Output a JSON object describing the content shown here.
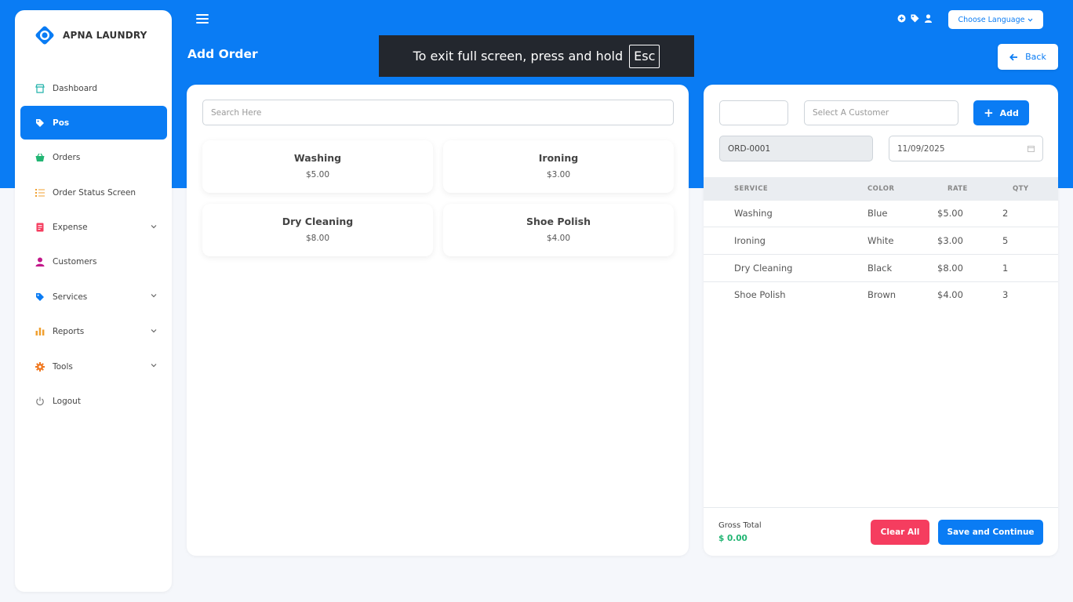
{
  "brand": {
    "name": "APNA LAUNDRY"
  },
  "sidebar": {
    "items": [
      {
        "label": "Dashboard",
        "icon": "shop-icon",
        "active": false
      },
      {
        "label": "Pos",
        "icon": "tag-icon",
        "active": true
      },
      {
        "label": "Orders",
        "icon": "basket-icon",
        "active": false
      },
      {
        "label": "Order Status Screen",
        "icon": "list-icon",
        "active": false
      },
      {
        "label": "Expense",
        "icon": "receipt-icon",
        "active": false,
        "expandable": true
      },
      {
        "label": "Customers",
        "icon": "user-icon",
        "active": false
      },
      {
        "label": "Services",
        "icon": "tag-icon",
        "active": false,
        "expandable": true
      },
      {
        "label": "Reports",
        "icon": "bar-chart-icon",
        "active": false,
        "expandable": true
      },
      {
        "label": "Tools",
        "icon": "gear-icon",
        "active": false,
        "expandable": true
      },
      {
        "label": "Logout",
        "icon": "power-icon",
        "active": false
      }
    ]
  },
  "header": {
    "language_label": "Choose Language",
    "page_title": "Add Order",
    "back_label": "Back",
    "icons": [
      "plus-circle-icon",
      "tag-icon",
      "user-icon"
    ]
  },
  "fullscreen_banner": {
    "text": "To exit full screen, press and hold",
    "key": "Esc"
  },
  "pos": {
    "search_placeholder": "Search Here",
    "services": [
      {
        "name": "Washing",
        "price": "$5.00"
      },
      {
        "name": "Ironing",
        "price": "$3.00"
      },
      {
        "name": "Dry Cleaning",
        "price": "$8.00"
      },
      {
        "name": "Shoe Polish",
        "price": "$4.00"
      }
    ]
  },
  "order": {
    "customer_placeholder": "Select A Customer",
    "add_label": "Add",
    "order_number": "ORD-0001",
    "date": "11/09/2025",
    "columns": [
      "SERVICE",
      "COLOR",
      "RATE",
      "QTY"
    ],
    "rows": [
      {
        "service": "Washing",
        "color": "Blue",
        "rate": "$5.00",
        "qty": "2"
      },
      {
        "service": "Ironing",
        "color": "White",
        "rate": "$3.00",
        "qty": "5"
      },
      {
        "service": "Dry Cleaning",
        "color": "Black",
        "rate": "$8.00",
        "qty": "1"
      },
      {
        "service": "Shoe Polish",
        "color": "Brown",
        "rate": "$4.00",
        "qty": "3"
      }
    ],
    "gross_total_label": "Gross Total",
    "gross_total_value": "$ 0.00",
    "clear_label": "Clear All",
    "save_label": "Save and Continue"
  },
  "colors": {
    "primary": "#0a7cf4",
    "danger": "#f53d5f",
    "success": "#22b573",
    "banner": "#23272e"
  }
}
